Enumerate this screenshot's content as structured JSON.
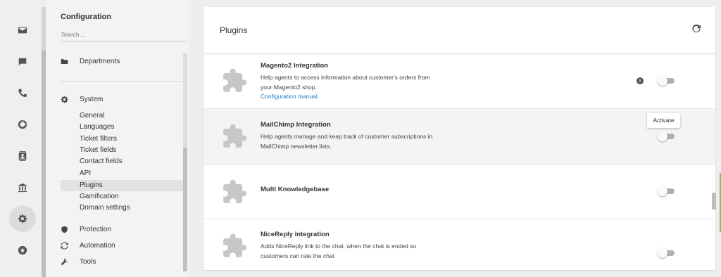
{
  "rail": {
    "items": [
      {
        "icon": "mail-icon"
      },
      {
        "icon": "chat-icon"
      },
      {
        "icon": "phone-icon"
      },
      {
        "icon": "reports-icon"
      },
      {
        "icon": "contacts-icon"
      },
      {
        "icon": "bank-icon"
      },
      {
        "icon": "settings-icon",
        "active": true
      },
      {
        "icon": "star-icon"
      }
    ]
  },
  "config": {
    "title": "Configuration",
    "search_placeholder": "Search ...",
    "departments_label": "Departments",
    "system_label": "System",
    "system_items": [
      "General",
      "Languages",
      "Ticket filters",
      "Ticket fields",
      "Contact fields",
      "API",
      "Plugins",
      "Gamification",
      "Domain settings"
    ],
    "active_item": "Plugins",
    "protection_label": "Protection",
    "automation_label": "Automation",
    "tools_label": "Tools"
  },
  "main": {
    "title": "Plugins",
    "tooltip": "Activate",
    "plugins": [
      {
        "name": "Magento2 Integration",
        "description": "Help agents to access information about customer's orders from your Magento2 shop.",
        "link": "Configuration manual.",
        "enabled": false
      },
      {
        "name": "MailChimp Integration",
        "description": "Help agents manage and keep track of customer subscriptions in MailChimp newsletter lists.",
        "enabled": false
      },
      {
        "name": "Multi Knowledgebase",
        "description": "",
        "enabled": false
      },
      {
        "name": "NiceReply integration",
        "description": "Adds NiceReply link to the chat, when the chat is ended so customers can rate the chat",
        "enabled": false
      }
    ]
  },
  "colors": {
    "link": "#1e7ac9",
    "puzzle": "#c7c7c7",
    "toggle_track": "#b0b0b0"
  }
}
